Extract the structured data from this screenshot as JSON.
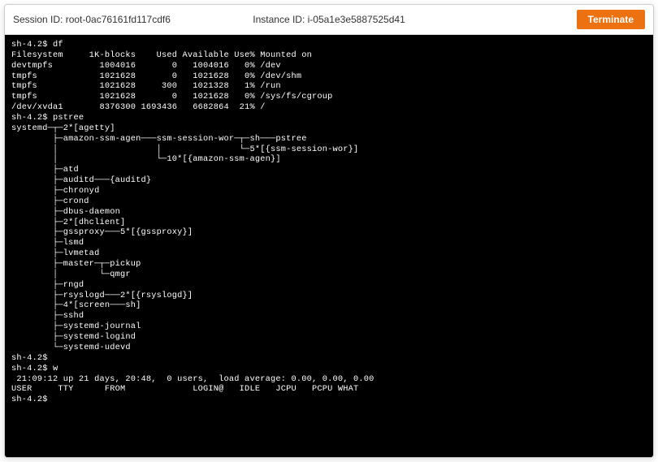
{
  "header": {
    "session_prefix": "Session ID: ",
    "session_id": "root-0ac76161fd117cdf6",
    "instance_prefix": "Instance ID: ",
    "instance_id": "i-05a1e3e5887525d41",
    "terminate_label": "Terminate"
  },
  "terminal": {
    "lines": [
      "sh-4.2$ df",
      "Filesystem     1K-blocks    Used Available Use% Mounted on",
      "devtmpfs         1004016       0   1004016   0% /dev",
      "tmpfs            1021628       0   1021628   0% /dev/shm",
      "tmpfs            1021628     300   1021328   1% /run",
      "tmpfs            1021628       0   1021628   0% /sys/fs/cgroup",
      "/dev/xvda1       8376300 1693436   6682864  21% /",
      "sh-4.2$ pstree",
      "systemd─┬─2*[agetty]",
      "        ├─amazon-ssm-agen───ssm-session-wor─┬─sh───pstree",
      "        │                   │               └─5*[{ssm-session-wor}]",
      "        │                   └─10*[{amazon-ssm-agen}]",
      "        ├─atd",
      "        ├─auditd───{auditd}",
      "        ├─chronyd",
      "        ├─crond",
      "        ├─dbus-daemon",
      "        ├─2*[dhclient]",
      "        ├─gssproxy───5*[{gssproxy}]",
      "        ├─lsmd",
      "        ├─lvmetad",
      "        ├─master─┬─pickup",
      "        │        └─qmgr",
      "        ├─rngd",
      "        ├─rsyslogd───2*[{rsyslogd}]",
      "        ├─4*[screen───sh]",
      "        ├─sshd",
      "        ├─systemd-journal",
      "        ├─systemd-logind",
      "        └─systemd-udevd",
      "sh-4.2$",
      "sh-4.2$ w",
      " 21:09:12 up 21 days, 20:48,  0 users,  load average: 0.00, 0.00, 0.00",
      "USER     TTY      FROM             LOGIN@   IDLE   JCPU   PCPU WHAT",
      "sh-4.2$"
    ]
  }
}
